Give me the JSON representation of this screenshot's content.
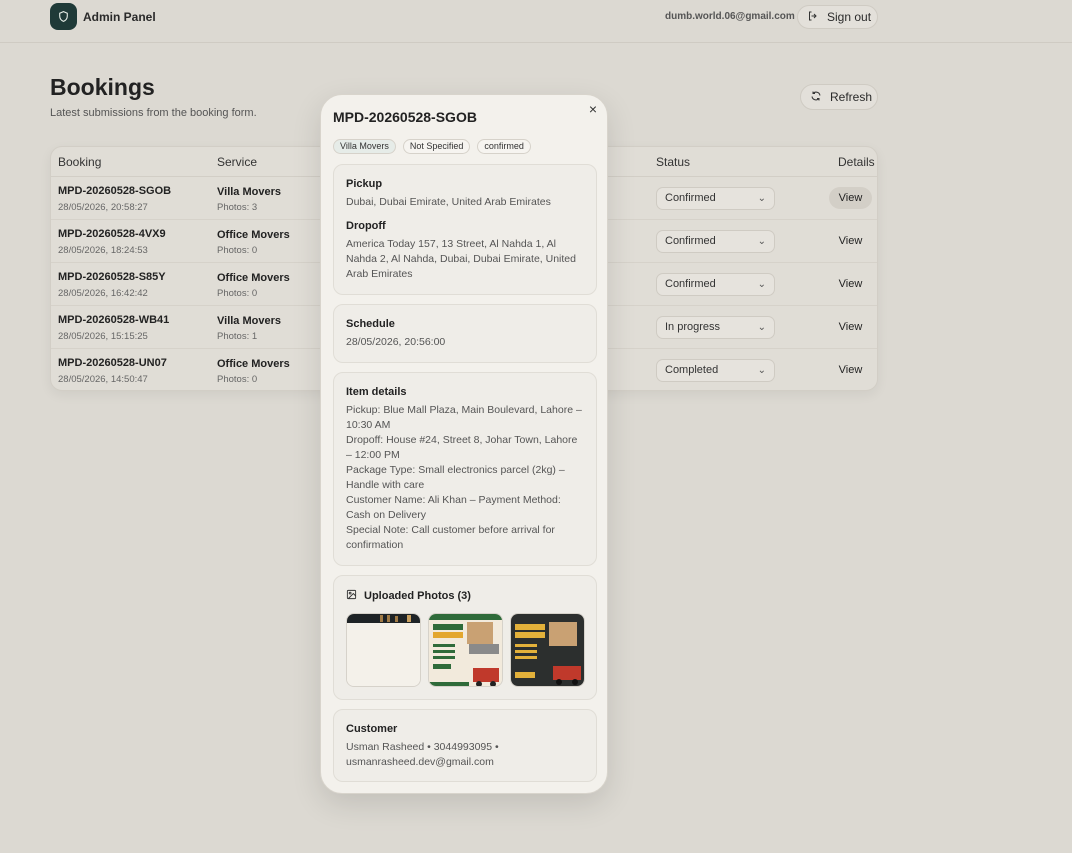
{
  "header": {
    "app_title": "Admin Panel",
    "user_email": "dumb.world.06@gmail.com",
    "sign_out_label": "Sign out"
  },
  "page": {
    "title": "Bookings",
    "subtitle": "Latest submissions from the booking form.",
    "refresh_label": "Refresh"
  },
  "table": {
    "headers": {
      "booking": "Booking",
      "service": "Service",
      "status": "Status",
      "details": "Details"
    },
    "rows": [
      {
        "id": "MPD-20260528-SGOB",
        "date": "28/05/2026, 20:58:27",
        "service": "Villa Movers",
        "photos": "Photos: 3",
        "status": "Confirmed",
        "view": "View"
      },
      {
        "id": "MPD-20260528-4VX9",
        "date": "28/05/2026, 18:24:53",
        "service": "Office Movers",
        "photos": "Photos: 0",
        "status": "Confirmed",
        "view": "View"
      },
      {
        "id": "MPD-20260528-S85Y",
        "date": "28/05/2026, 16:42:42",
        "service": "Office Movers",
        "photos": "Photos: 0",
        "status": "Confirmed",
        "view": "View"
      },
      {
        "id": "MPD-20260528-WB41",
        "date": "28/05/2026, 15:15:25",
        "service": "Villa Movers",
        "photos": "Photos: 1",
        "status": "In progress",
        "view": "View"
      },
      {
        "id": "MPD-20260528-UN07",
        "date": "28/05/2026, 14:50:47",
        "service": "Office Movers",
        "photos": "Photos: 0",
        "status": "Completed",
        "view": "View"
      }
    ]
  },
  "modal": {
    "title": "MPD-20260528-SGOB",
    "close": "×",
    "chips": [
      "Villa Movers",
      "Not Specified",
      "confirmed"
    ],
    "pickup_label": "Pickup",
    "pickup_value": "Dubai, Dubai Emirate, United Arab Emirates",
    "dropoff_label": "Dropoff",
    "dropoff_value": "America Today 157, 13 Street, Al Nahda 1, Al Nahda 2, Al Nahda, Dubai, Dubai Emirate, United Arab Emirates",
    "schedule_label": "Schedule",
    "schedule_value": "28/05/2026, 20:56:00",
    "items_label": "Item details",
    "items_lines": [
      "Pickup: Blue Mall Plaza, Main Boulevard, Lahore – 10:30 AM",
      "Dropoff: House #24, Street 8, Johar Town, Lahore – 12:00 PM",
      "Package Type: Small electronics parcel (2kg) – Handle with care",
      "Customer Name: Ali Khan – Payment Method: Cash on Delivery",
      "Special Note: Call customer before arrival for confirmation"
    ],
    "photos_label": "Uploaded Photos (3)",
    "customer_label": "Customer",
    "customer_value": "Usman Rasheed • 3044993095 • usmanrasheed.dev@gmail.com"
  },
  "colors": {
    "background": "#dcd9d2",
    "brand_badge": "#1f3a38",
    "modal_bg": "#f3f1ec"
  }
}
